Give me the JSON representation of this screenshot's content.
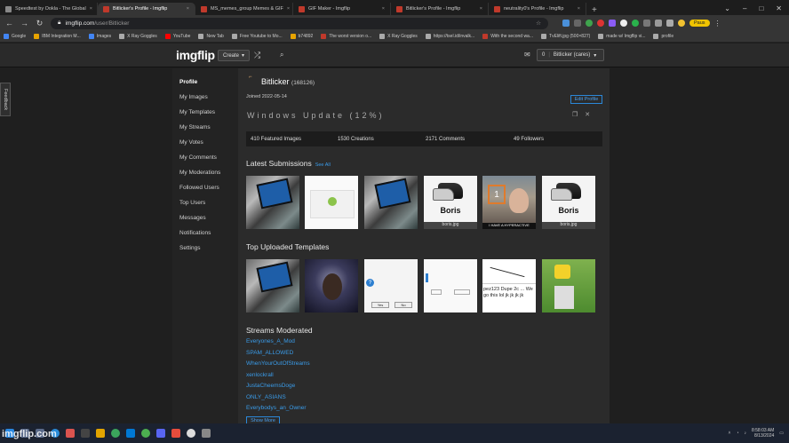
{
  "tabs": [
    {
      "label": "Speedtest by Ookla - The Global",
      "active": false
    },
    {
      "label": "Bitlicker's Profile - Imgflip",
      "active": true
    },
    {
      "label": "MS_memes_group Memes & GIF",
      "active": false
    },
    {
      "label": "GIF Maker - Imgflip",
      "active": false
    },
    {
      "label": "Bitlicker's Profile - Imgflip",
      "active": false
    },
    {
      "label": "neutrality0's Profile - Imgflip",
      "active": false
    }
  ],
  "address": {
    "domain": "imgflip.com",
    "path": "/user/Bitlicker",
    "paused_label": "Paus"
  },
  "bookmarks": [
    "Google",
    "IBM Integration M...",
    "Images",
    "X Ray Goggles",
    "YouTube",
    "New Tab",
    "Free Youtube to Mo...",
    "b74892",
    "The worst version o...",
    "X Ray Goggles",
    "https://tsel.id/invalk...",
    "With the second wa...",
    "TvElift.jpg (500×827)",
    "made w/ Imgflip vi...",
    "profile"
  ],
  "site": {
    "logo": "imgflip",
    "create_label": "Create",
    "user_label": "Bitlicker (cares)",
    "user_count": "0",
    "feedback_label": "Feedback"
  },
  "sidebar": [
    "Profile",
    "My Images",
    "My Templates",
    "My Streams",
    "My Votes",
    "My Comments",
    "My Moderations",
    "Followed Users",
    "Top Users",
    "Messages",
    "Notifications",
    "Settings"
  ],
  "profile": {
    "username": "Bitlicker",
    "points": "(168126)",
    "joined": "Joined 2022-05-14",
    "edit_label": "Edit Profile",
    "blurb": "Windows Update (12%)",
    "stats": [
      "410 Featured Images",
      "1530 Creations",
      "2171 Comments",
      "49 Followers"
    ]
  },
  "latest": {
    "title": "Latest Submissions",
    "see_all": "See All",
    "thumbs": [
      {
        "kind": "tablet",
        "caption": ""
      },
      {
        "kind": "white",
        "caption": ""
      },
      {
        "kind": "tablet",
        "caption": ""
      },
      {
        "kind": "shoe",
        "caption": "boris.jpg",
        "text": "Boris"
      },
      {
        "kind": "photo",
        "caption": "",
        "text": "1",
        "bar": "I HAVE A HYPERACTIVE"
      },
      {
        "kind": "shoe",
        "caption": "boris.jpg",
        "text": "Boris"
      }
    ]
  },
  "templates": {
    "title": "Top Uploaded Templates",
    "thumbs": [
      {
        "kind": "tablet"
      },
      {
        "kind": "dark"
      },
      {
        "kind": "dialog",
        "yes": "Yes",
        "no": "No"
      },
      {
        "kind": "dialog2"
      },
      {
        "kind": "text",
        "text": "pez123 Dupe 2c ... We go this lol jk jk jk jk"
      },
      {
        "kind": "lego"
      }
    ]
  },
  "streams": {
    "title": "Streams Moderated",
    "items": [
      "Everyones_A_Mod",
      "SPAM_ALLOWED",
      "WhenYourOutOfStreams",
      "xenlockrall",
      "JustaCheemsDoge",
      "ONLY_ASIANS",
      "Everybodys_an_Owner"
    ],
    "show_more": "Show More"
  },
  "taskbar": {
    "time": "8:58:03 AM",
    "date": "8/13/2024",
    "watermark": "imgflip.com"
  }
}
